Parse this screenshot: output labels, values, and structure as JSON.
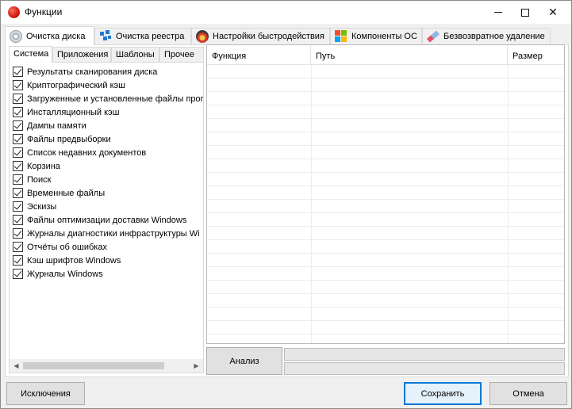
{
  "window": {
    "title": "Функции"
  },
  "tabs": [
    {
      "label": "Очистка диска",
      "icon": "disk-icon"
    },
    {
      "label": "Очистка реестра",
      "icon": "registry-icon"
    },
    {
      "label": "Настройки быстродействия",
      "icon": "performance-gauge-icon"
    },
    {
      "label": "Компоненты ОС",
      "icon": "windows-logo-icon"
    },
    {
      "label": "Безвозвратное удаление",
      "icon": "eraser-icon"
    }
  ],
  "subtabs": [
    "Система",
    "Приложения",
    "Шаблоны",
    "Прочее"
  ],
  "items": [
    {
      "label": "Результаты сканирования диска",
      "checked": true
    },
    {
      "label": "Криптографический кэш",
      "checked": true
    },
    {
      "label": "Загруженные и установленные файлы прог",
      "checked": true
    },
    {
      "label": "Инсталляционный кэш",
      "checked": true
    },
    {
      "label": "Дампы памяти",
      "checked": true
    },
    {
      "label": "Файлы предвыборки",
      "checked": true
    },
    {
      "label": "Список недавних документов",
      "checked": true
    },
    {
      "label": "Корзина",
      "checked": true
    },
    {
      "label": "Поиск",
      "checked": true
    },
    {
      "label": "Временные файлы",
      "checked": true
    },
    {
      "label": "Эскизы",
      "checked": true
    },
    {
      "label": "Файлы оптимизации доставки Windows",
      "checked": true
    },
    {
      "label": "Журналы диагностики инфраструктуры Wi",
      "checked": true
    },
    {
      "label": "Отчёты об ошибках",
      "checked": true
    },
    {
      "label": "Кэш шрифтов Windows",
      "checked": true
    },
    {
      "label": "Журналы Windows",
      "checked": true
    }
  ],
  "table": {
    "columns": [
      "Функция",
      "Путь",
      "Размер"
    ]
  },
  "buttons": {
    "analyze": "Анализ",
    "exclusions": "Исключения",
    "save": "Сохранить",
    "cancel": "Отмена"
  },
  "colors": {
    "accent": "#0078d7",
    "app_icon": "#d11a0e"
  }
}
